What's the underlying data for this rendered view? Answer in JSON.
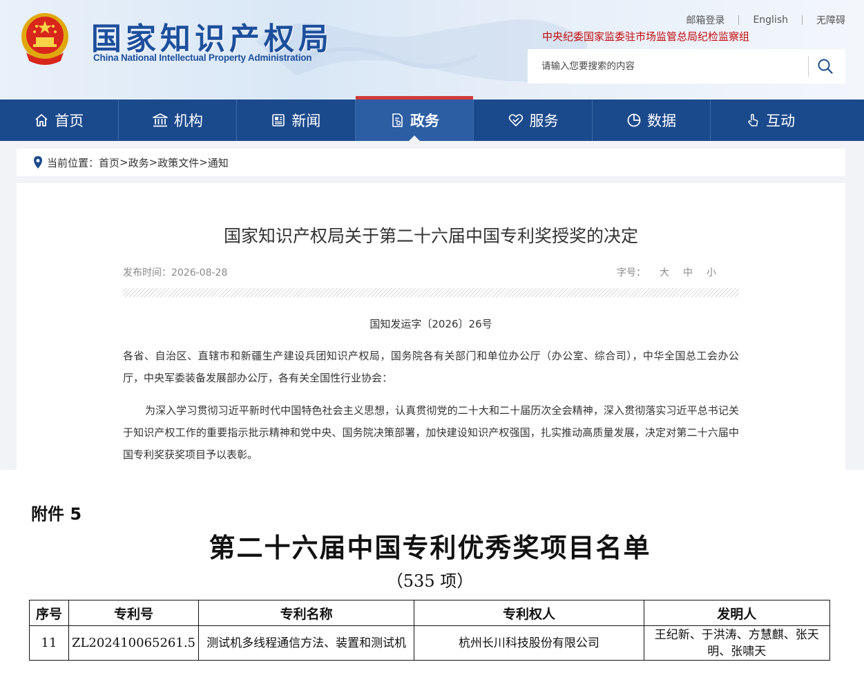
{
  "header": {
    "logo_cn": "国家知识产权局",
    "logo_en": "China National Intellectual Property Administration",
    "top_links": [
      "邮箱登录",
      "English",
      "无障碍"
    ],
    "supervision": "中央纪委国家监委驻市场监管总局纪检监察组",
    "search": {
      "placeholder": "请输入您要搜索的内容"
    }
  },
  "nav": {
    "items": [
      {
        "label": "首页",
        "icon": "home-icon"
      },
      {
        "label": "机构",
        "icon": "institution-icon"
      },
      {
        "label": "新闻",
        "icon": "news-icon"
      },
      {
        "label": "政务",
        "icon": "government-icon",
        "active": true
      },
      {
        "label": "服务",
        "icon": "service-icon"
      },
      {
        "label": "数据",
        "icon": "data-icon"
      },
      {
        "label": "互动",
        "icon": "interact-icon"
      }
    ]
  },
  "breadcrumb": {
    "prefix": "当前位置：",
    "items": [
      "首页",
      "政务",
      "政策文件",
      "通知"
    ],
    "sep": ">"
  },
  "article": {
    "title": "国家知识产权局关于第二十六届中国专利奖授奖的决定",
    "publish_label": "发布时间：",
    "publish_date": "2026-08-28",
    "font_size_label": "字号：",
    "font_sizes": [
      "大",
      "中",
      "小"
    ],
    "doc_number": "国知发运字〔2026〕26号",
    "paragraphs": [
      "各省、自治区、直辖市和新疆生产建设兵团知识产权局，国务院各有关部门和单位办公厅（办公室、综合司），中华全国总工会办公厅，中央军委装备发展部办公厅，各有关全国性行业协会：",
      "为深入学习贯彻习近平新时代中国特色社会主义思想，认真贯彻党的二十大和二十届历次全会精神，深入贯彻落实习近平总书记关于知识产权工作的重要指示批示精神和党中央、国务院决策部署，加快建设知识产权强国，扎实推动高质量发展，决定对第二十六届中国专利奖获奖项目予以表彰。"
    ]
  },
  "attachment": {
    "label": "附件 5",
    "title": "第二十六届中国专利优秀奖项目名单",
    "count": "（535 项）",
    "table": {
      "headers": [
        "序号",
        "专利号",
        "专利名称",
        "专利权人",
        "发明人"
      ],
      "rows": [
        [
          "11",
          "ZL202410065261.5",
          "测试机多线程通信方法、装置和测试机",
          "杭州长川科技股份有限公司",
          "王纪新、于洪涛、方慧麒、张天明、张啸天"
        ]
      ]
    }
  },
  "colors": {
    "brand_blue": "#1b4a8c",
    "nav_active": "#2c5ea4",
    "alert_red": "#c20a0a"
  }
}
